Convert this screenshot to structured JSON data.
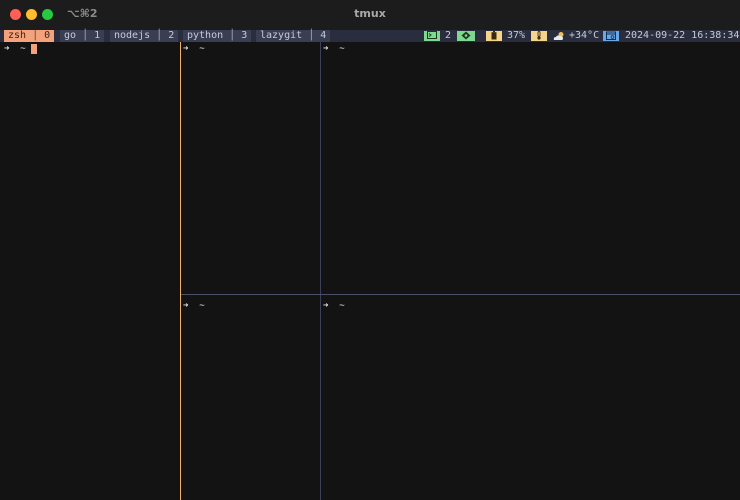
{
  "window": {
    "title": "tmux",
    "shortcut": "⌥⌘2"
  },
  "status": {
    "windows": [
      {
        "name": "zsh",
        "index": "0",
        "active": true
      },
      {
        "name": "go",
        "index": "1",
        "active": false
      },
      {
        "name": "nodejs",
        "index": "2",
        "active": false
      },
      {
        "name": "python",
        "index": "3",
        "active": false
      },
      {
        "name": "lazygit",
        "index": "4",
        "active": false
      }
    ],
    "session_count": "2",
    "battery": "37%",
    "weather": "+34°C",
    "datetime": "2024-09-22 16:38:34",
    "colors": {
      "active_window": "#f4a27c",
      "inactive_window": "#3a3e52",
      "bar_bg": "#2a2d3e",
      "session_badge": "#7fd88f",
      "battery_badge": "#f5d58a",
      "calendar_badge": "#6aa7e8"
    },
    "icons": {
      "terminal": "terminal-icon",
      "git": "git-icon",
      "battery": "battery-icon",
      "thermometer": "thermometer-icon",
      "weather": "partly-cloudy-icon",
      "calendar": "calendar-icon"
    }
  },
  "prompt": {
    "arrow": "➜",
    "path": "~"
  }
}
